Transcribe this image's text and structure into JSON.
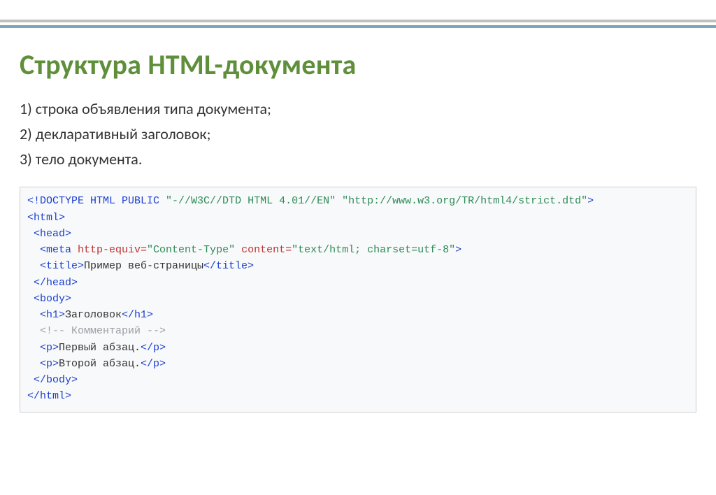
{
  "title": "Структура HTML-документа",
  "bullets": {
    "b1": "1) строка объявления типа документа;",
    "b2": "2) декларативный заголовок;",
    "b3": "3) тело документа."
  },
  "code": {
    "l1_tag": "<!DOCTYPE HTML PUBLIC ",
    "l1_val": "\"-//W3C//DTD HTML 4.01//EN\" \"http://www.w3.org/TR/html4/strict.dtd\"",
    "l1_end": ">",
    "l2": "<html>",
    "l3": " <head>",
    "l4_open": "  <meta ",
    "l4_attr1": "http-equiv=",
    "l4_val1": "\"Content-Type\"",
    "l4_space": " ",
    "l4_attr2": "content=",
    "l4_val2": "\"text/html; charset=utf-8\"",
    "l4_end": ">",
    "l5_open": "  <title>",
    "l5_text": "Пример веб-страницы",
    "l5_close": "</title>",
    "l6": " </head>",
    "l7": " <body>",
    "l8_open": "  <h1>",
    "l8_text": "Заголовок",
    "l8_close": "</h1>",
    "l9": "  <!-- Комментарий -->",
    "l10_open": "  <p>",
    "l10_text": "Первый абзац.",
    "l10_close": "</p>",
    "l11_open": "  <p>",
    "l11_text": "Второй абзац.",
    "l11_close": "</p>",
    "l12": " </body>",
    "l13": "</html>"
  }
}
